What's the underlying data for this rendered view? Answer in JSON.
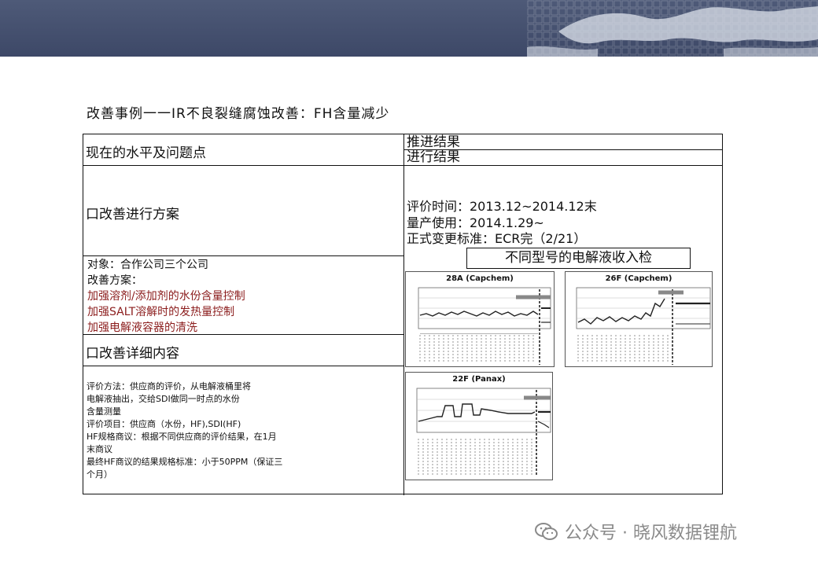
{
  "slide": {
    "title": "改善事例一一IR不良裂缝腐蚀改善：FH含量减少"
  },
  "left": {
    "current_level": "现在的水平及问题点",
    "plan_heading": "口改善进行方案",
    "plan_lines": [
      "对象：合作公司三个公司",
      "改善方案：",
      "加强溶剂/添加剂的水份含量控制",
      "加强SALT溶解时的发热量控制",
      "加强电解液容器的清洗"
    ],
    "detail_heading": "口改善详细内容",
    "detail_lines": [
      "评价方法：供应商的评价，从电解液桶里将",
      "电解液抽出，交给SDI做同一时点的水份",
      "含量测量",
      "评价项目：供应商（水份，HF),SDI(HF)",
      "HF规格商议：根据不同供应商的评价结果，在1月",
      "末商议",
      "最终HF商议的结果规格标准：小于50PPM（保证三",
      "个月）"
    ]
  },
  "right": {
    "progress": "推进结果",
    "result": "进行结果",
    "eval_time": "评价时间：2013.12~2014.12末",
    "mass_use": "量产使用：2014.1.29~",
    "formal_change": "正式变更标准：ECR完（2/21）",
    "box_label": "不同型号的电解液收入检"
  },
  "chart_data": [
    {
      "type": "line",
      "title": "28A (Capchem)"
    },
    {
      "type": "line",
      "title": "26F (Capchem)"
    },
    {
      "type": "line",
      "title": "22F (Panax)"
    }
  ],
  "footer": {
    "text": "公众号 · 晓风数据锂航"
  },
  "icons": {
    "banner": "world-map-icon",
    "footer": "wechat-icon"
  }
}
